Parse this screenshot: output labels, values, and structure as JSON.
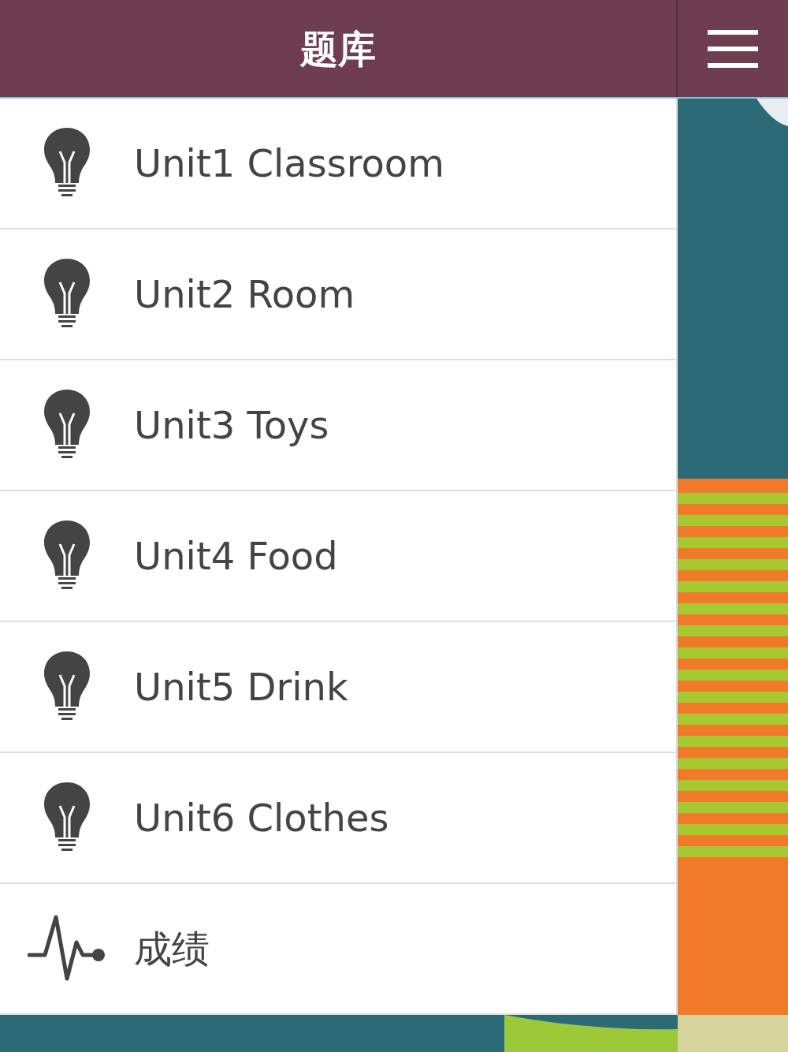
{
  "header": {
    "title": "题库"
  },
  "menu": [
    {
      "label": "Unit1 Classroom",
      "kind": "bulb"
    },
    {
      "label": "Unit2 Room",
      "kind": "bulb"
    },
    {
      "label": "Unit3 Toys",
      "kind": "bulb"
    },
    {
      "label": "Unit4 Food",
      "kind": "bulb"
    },
    {
      "label": "Unit5 Drink",
      "kind": "bulb"
    },
    {
      "label": "Unit6 Clothes",
      "kind": "bulb"
    },
    {
      "label": "成绩",
      "kind": "pulse"
    }
  ]
}
